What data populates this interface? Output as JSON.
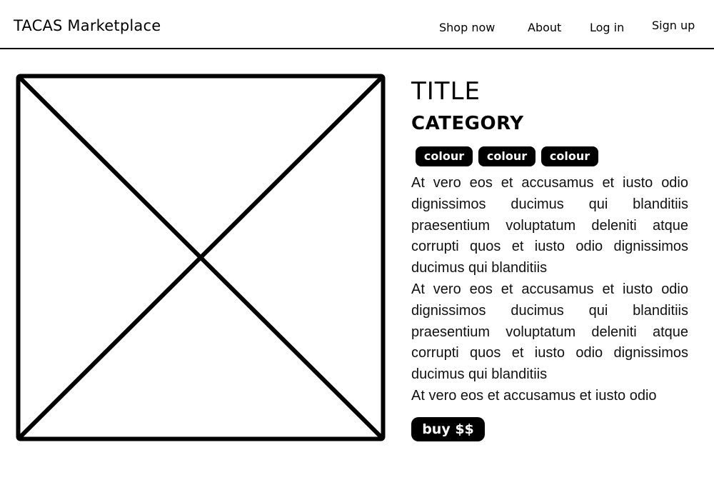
{
  "header": {
    "brand": "TACAS Marketplace",
    "nav": [
      {
        "label": "Shop now"
      },
      {
        "label": "About"
      },
      {
        "label": "Log in"
      },
      {
        "label": "Sign up"
      }
    ]
  },
  "product": {
    "image_icon": "image-placeholder-icon",
    "title": "TITLE",
    "category": "CATEGORY",
    "colours": [
      {
        "label": "colour"
      },
      {
        "label": "colour"
      },
      {
        "label": "colour"
      }
    ],
    "description": [
      "At vero eos et accusamus et iusto odio dignissimos ducimus qui blanditiis praesentium voluptatum deleniti atque corrupti quos et iusto odio dignissimos ducimus qui blanditiis",
      "At vero eos et accusamus et iusto odio dignissimos ducimus qui blanditiis praesentium voluptatum deleniti atque corrupti quos et iusto odio dignissimos ducimus qui blanditiis",
      "At vero eos et accusamus et iusto odio"
    ],
    "buy_label": "buy $$"
  },
  "colors": {
    "background": "#ffffff",
    "ink": "#000000",
    "chip_text": "#ffffff"
  }
}
